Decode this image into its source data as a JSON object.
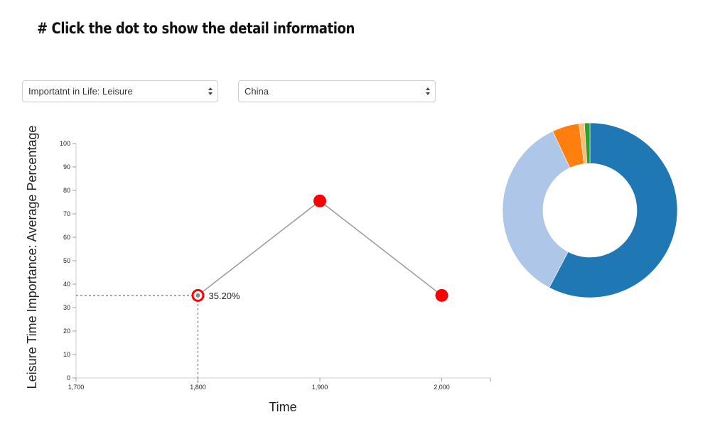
{
  "heading": "# Click the dot to show the detail information",
  "controls": {
    "measure_select": {
      "value": "Importatnt in Life: Leisure"
    },
    "country_select": {
      "value": "China"
    }
  },
  "chart_data": [
    {
      "type": "line",
      "xlabel": "Time",
      "ylabel": "Leisure Time Importance: Average Percentage",
      "xlim": [
        1700,
        2000
      ],
      "ylim": [
        0,
        100
      ],
      "x_ticks": [
        "1,700",
        "1,800",
        "1,900",
        "2,000"
      ],
      "y_ticks": [
        "0",
        "10",
        "20",
        "30",
        "40",
        "50",
        "60",
        "70",
        "80",
        "90",
        "100"
      ],
      "grid": false,
      "series": [
        {
          "x": [
            1800,
            1900,
            2000
          ],
          "values": [
            35.2,
            75.5,
            35.2
          ]
        }
      ],
      "selected_index": 0,
      "selected_label": "35.20%",
      "colors": {
        "line": "#999999",
        "point": "#ff0000",
        "selected_ring": "#ff0000"
      }
    },
    {
      "type": "pie",
      "donut": true,
      "slices": [
        {
          "value": 57.7,
          "color": "#1f77b4"
        },
        {
          "value": 35.3,
          "color": "#aec7e8"
        },
        {
          "value": 5.0,
          "color": "#ff7f0e"
        },
        {
          "value": 1.0,
          "color": "#ffbb78"
        },
        {
          "value": 1.0,
          "color": "#2ca02c"
        }
      ]
    }
  ]
}
